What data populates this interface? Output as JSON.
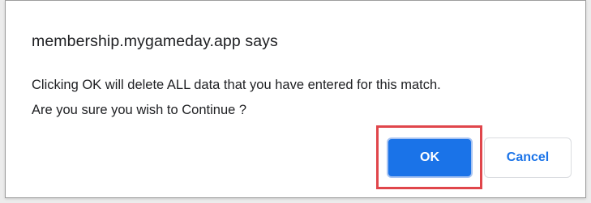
{
  "dialog": {
    "title": "membership.mygameday.app says",
    "message_lines": [
      "Clicking OK will delete ALL data that you have entered for this match.",
      "Are you sure you wish to Continue ?"
    ],
    "buttons": {
      "ok_label": "OK",
      "cancel_label": "Cancel"
    }
  },
  "colors": {
    "primary_button": "#1a73e8",
    "highlight_outline": "#e0464b"
  }
}
